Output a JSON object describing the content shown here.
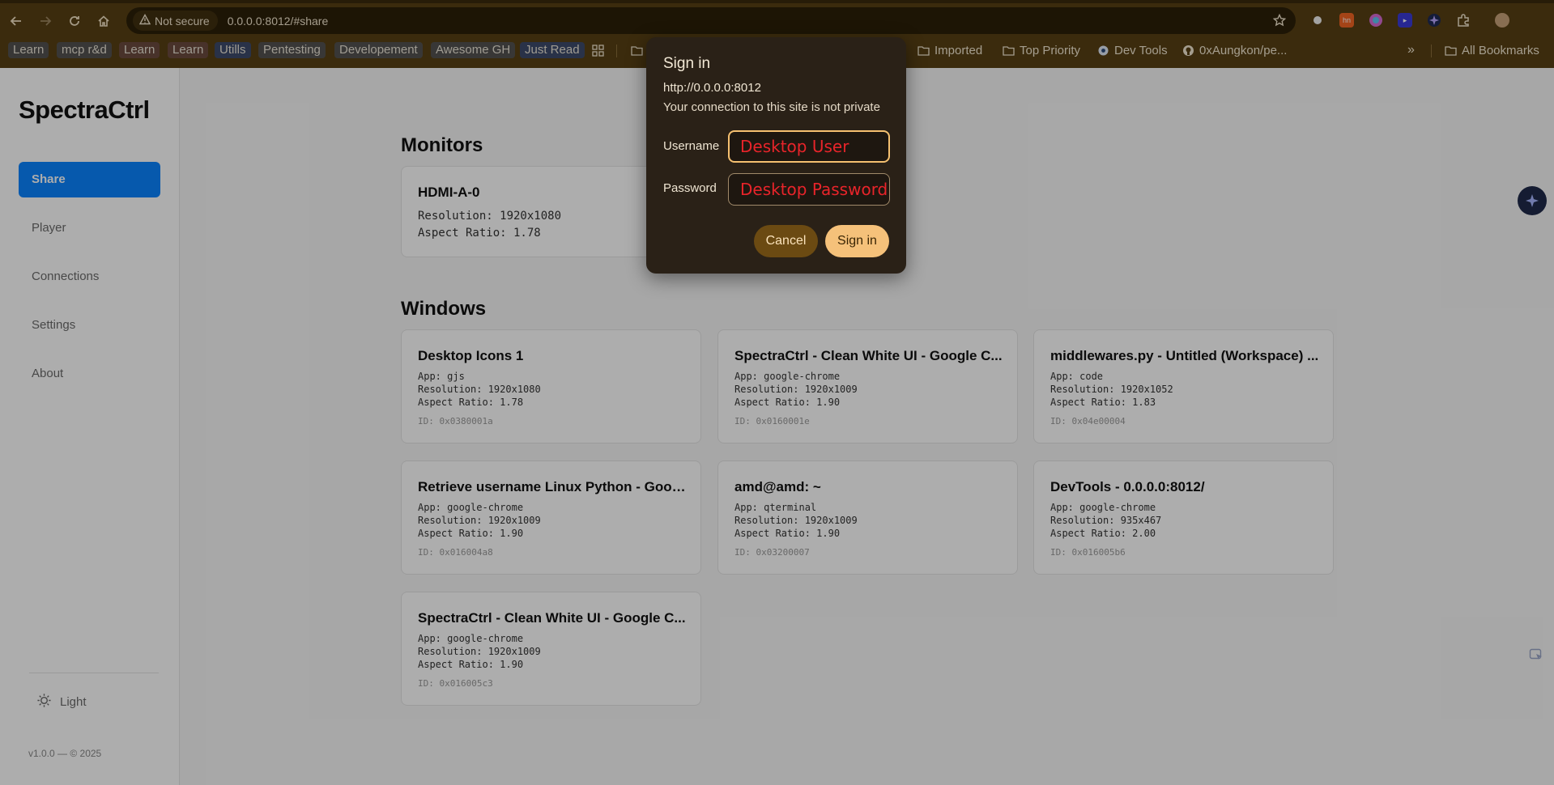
{
  "browser": {
    "security_label": "Not secure",
    "url": "0.0.0.0:8012/#share",
    "bookmarks": [
      {
        "label": "Learn",
        "bg": "#535250"
      },
      {
        "label": "mcp r&d",
        "bg": "#535250"
      },
      {
        "label": "Learn",
        "bg": "#6a4a3e"
      },
      {
        "label": "Learn",
        "bg": "#6a4a3e"
      },
      {
        "label": "Utills",
        "bg": "#3d4b6b"
      },
      {
        "label": "Pentesting",
        "bg": "#535250"
      },
      {
        "label": "Developement",
        "bg": "#535250"
      },
      {
        "label": "Awesome GH",
        "bg": "#535250"
      },
      {
        "label": "Just Read",
        "bg": "#3d4b6b"
      }
    ],
    "bookmark_folders": [
      "Imported",
      "Top Priority",
      "Dev Tools",
      "0xAungkon/pe...",
      "All Bookmarks"
    ],
    "overflow_label": "»"
  },
  "sidebar": {
    "brand": "SpectraCtrl",
    "items": [
      "Share",
      "Player",
      "Connections",
      "Settings",
      "About"
    ],
    "active": "Share",
    "theme_label": "Light",
    "footer": "v1.0.0 — © 2025"
  },
  "main": {
    "monitors_title": "Monitors",
    "monitor": {
      "name": "HDMI-A-0",
      "resolution": "Resolution: 1920x1080",
      "aspect": "Aspect Ratio: 1.78"
    },
    "windows_title": "Windows",
    "windows": [
      {
        "title": "Desktop Icons 1",
        "app": "App: gjs",
        "resolution": "Resolution: 1920x1080",
        "aspect": "Aspect Ratio: 1.78",
        "id": "ID: 0x0380001a"
      },
      {
        "title": "SpectraCtrl - Clean White UI - Google C...",
        "app": "App: google-chrome",
        "resolution": "Resolution: 1920x1009",
        "aspect": "Aspect Ratio: 1.90",
        "id": "ID: 0x0160001e"
      },
      {
        "title": "middlewares.py - Untitled (Workspace) ...",
        "app": "App: code",
        "resolution": "Resolution: 1920x1052",
        "aspect": "Aspect Ratio: 1.83",
        "id": "ID: 0x04e00004"
      },
      {
        "title": "Retrieve username Linux Python - Googl...",
        "app": "App: google-chrome",
        "resolution": "Resolution: 1920x1009",
        "aspect": "Aspect Ratio: 1.90",
        "id": "ID: 0x016004a8"
      },
      {
        "title": "amd@amd: ~",
        "app": "App: qterminal",
        "resolution": "Resolution: 1920x1009",
        "aspect": "Aspect Ratio: 1.90",
        "id": "ID: 0x03200007"
      },
      {
        "title": "DevTools - 0.0.0.0:8012/",
        "app": "App: google-chrome",
        "resolution": "Resolution: 935x467",
        "aspect": "Aspect Ratio: 2.00",
        "id": "ID: 0x016005b6"
      },
      {
        "title": "SpectraCtrl - Clean White UI - Google C...",
        "app": "App: google-chrome",
        "resolution": "Resolution: 1920x1009",
        "aspect": "Aspect Ratio: 1.90",
        "id": "ID: 0x016005c3"
      }
    ]
  },
  "dialog": {
    "title": "Sign in",
    "url": "http://0.0.0.0:8012",
    "subtitle": "Your connection to this site is not private",
    "username_label": "Username",
    "username_value": "Desktop User",
    "password_label": "Password",
    "password_value": "Desktop Password",
    "cancel_label": "Cancel",
    "signin_label": "Sign in"
  }
}
